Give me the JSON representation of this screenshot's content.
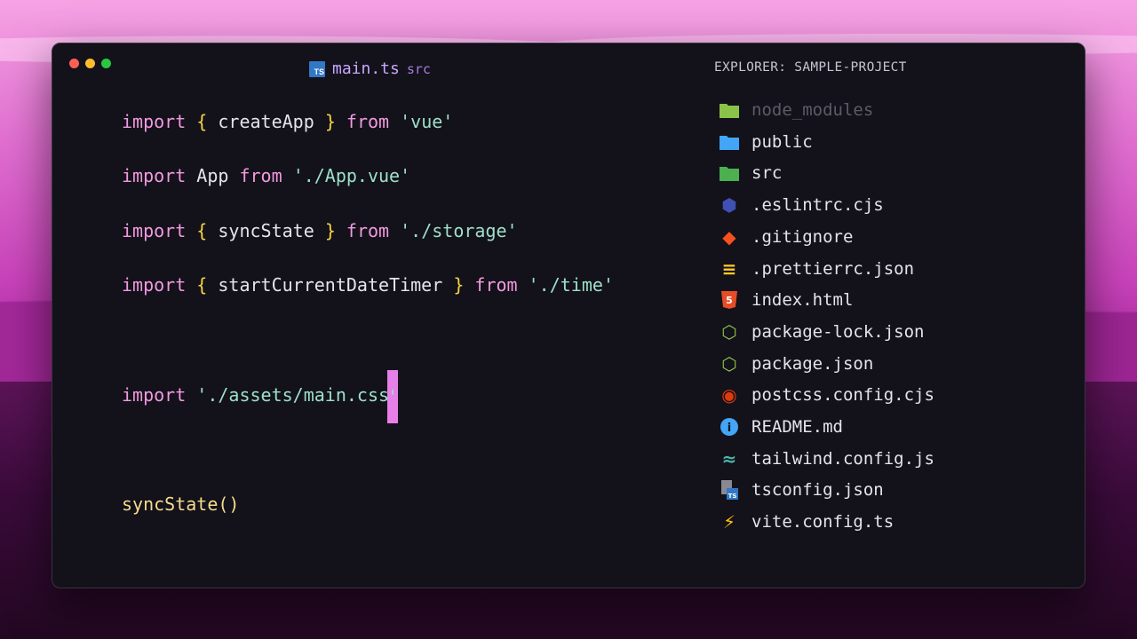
{
  "window": {
    "tab": {
      "filename": "main.ts",
      "dir": "src"
    },
    "explorer_title": "EXPLORER: SAMPLE-PROJECT"
  },
  "code": {
    "l1": {
      "a": "import",
      "b": "{",
      "c": "createApp",
      "d": "}",
      "e": "from",
      "f": "'vue'"
    },
    "l2": {
      "a": "import",
      "b": "App",
      "c": "from",
      "d": "'./App.vue'"
    },
    "l3": {
      "a": "import",
      "b": "{",
      "c": "syncState",
      "d": "}",
      "e": "from",
      "f": "'./storage'"
    },
    "l4": {
      "a": "import",
      "b": "{",
      "c": "startCurrentDateTimer",
      "d": "}",
      "e": "from",
      "f": "'./time'"
    },
    "l5": {
      "a": "import",
      "b": "'./assets/main.css",
      "c": "'"
    },
    "l6": {
      "a": "syncState()"
    }
  },
  "explorer": {
    "items": [
      {
        "label": "node_modules",
        "icon": "folder-node-icon",
        "color": "#8bc34a",
        "dim": true
      },
      {
        "label": "public",
        "icon": "folder-public-icon",
        "color": "#42a5f5"
      },
      {
        "label": "src",
        "icon": "folder-src-icon",
        "color": "#4caf50"
      },
      {
        "label": ".eslintrc.cjs",
        "icon": "eslint-icon",
        "color": "#3f51b5"
      },
      {
        "label": ".gitignore",
        "icon": "git-icon",
        "color": "#f4511e"
      },
      {
        "label": ".prettierrc.json",
        "icon": "prettier-icon",
        "color": "#ffca28"
      },
      {
        "label": "index.html",
        "icon": "html-icon",
        "color": "#e44d26"
      },
      {
        "label": "package-lock.json",
        "icon": "nodejs-icon",
        "color": "#8bc34a"
      },
      {
        "label": "package.json",
        "icon": "nodejs-icon",
        "color": "#8bc34a"
      },
      {
        "label": "postcss.config.cjs",
        "icon": "postcss-icon",
        "color": "#dd3a0a"
      },
      {
        "label": "README.md",
        "icon": "info-icon",
        "color": "#42a5f5"
      },
      {
        "label": "tailwind.config.js",
        "icon": "tailwind-icon",
        "color": "#4db6ac"
      },
      {
        "label": "tsconfig.json",
        "icon": "tsconfig-icon",
        "color": "#3178c6"
      },
      {
        "label": "vite.config.ts",
        "icon": "vite-icon",
        "color": "#ffc107"
      }
    ]
  }
}
